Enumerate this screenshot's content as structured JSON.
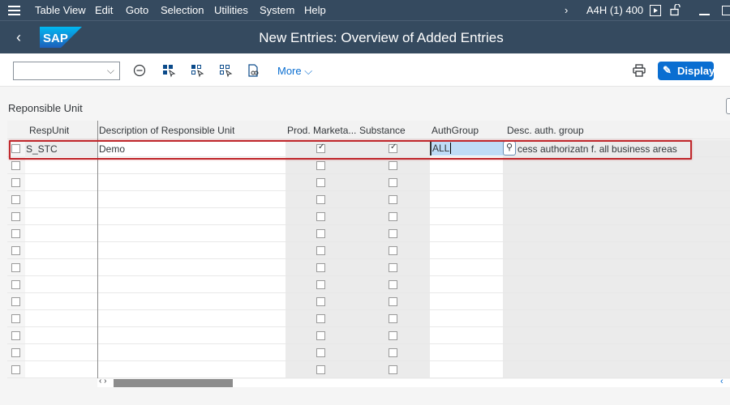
{
  "menubar": {
    "items": [
      "Table View",
      "Edit",
      "Goto",
      "Selection",
      "Utilities",
      "System",
      "Help"
    ],
    "system_info": "A4H (1) 400"
  },
  "shell": {
    "title": "New Entries: Overview of Added Entries",
    "logo_text": "SAP"
  },
  "toolbar": {
    "dropdown_value": "",
    "more_label": "More",
    "display_label": "Display"
  },
  "section": {
    "title": "Reponsible Unit"
  },
  "table": {
    "columns": [
      "RespUnit",
      "Description of Responsible Unit",
      "Prod. Marketa...",
      "Substance",
      "AuthGroup",
      "Desc. auth. group"
    ],
    "rows": [
      {
        "resp_unit": "S_STC",
        "description": "Demo",
        "prod_marketability": true,
        "substance": true,
        "auth_group": "ALL",
        "desc_auth_group": "cess authorizatn f. all business areas"
      }
    ],
    "empty_rows": 13
  },
  "colors": {
    "shell": "#354a5f",
    "accent": "#0a6ed1",
    "highlight": "#c0282c"
  }
}
